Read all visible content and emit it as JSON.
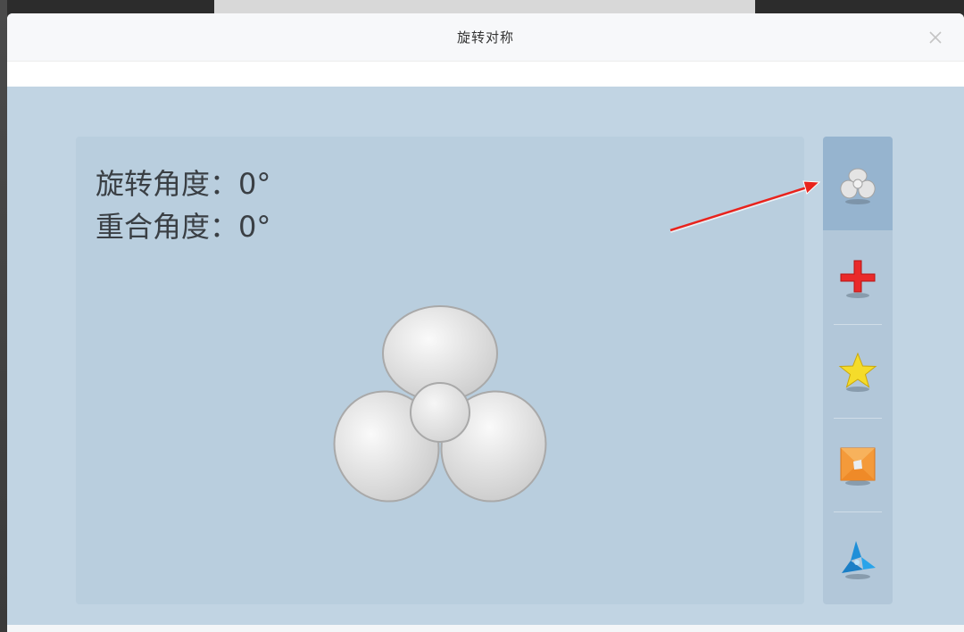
{
  "dialog": {
    "title": "旋转对称"
  },
  "readout": {
    "rotation_label": "旋转角度：",
    "rotation_value": "0°",
    "overlap_label": "重合角度：",
    "overlap_value": "0°"
  },
  "sidebar": {
    "items": [
      {
        "icon": "fan-icon",
        "selected": true
      },
      {
        "icon": "red-cross-icon",
        "selected": false
      },
      {
        "icon": "star-icon",
        "selected": false
      },
      {
        "icon": "pinwheel-square-icon",
        "selected": false
      },
      {
        "icon": "blue-tri-blade-icon",
        "selected": false
      }
    ]
  },
  "colors": {
    "content_bg": "#c1d4e3",
    "stage_bg": "#b9cede",
    "sidebar_bg": "#b2c7d9",
    "sidebar_active": "#96b4cf",
    "arrow": "#e8231d"
  }
}
